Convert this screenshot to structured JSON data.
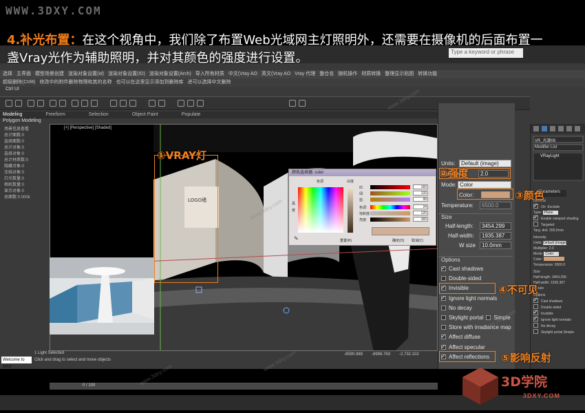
{
  "watermark_top": "WWW.3DXY.COM",
  "headline": {
    "step": "4.补光布置：",
    "text": "在这个视角中，我们除了布置Web光域网主灯照明外，还需要在摄像机的后面布置一盏Vray光作为辅助照明，并对其颜色的强度进行设置。"
  },
  "max_ui": {
    "search_placeholder": "Type a keyword or phrase",
    "menu_row1": [
      "选择",
      "主界面",
      "模型场景创建",
      "渲染对象设置(id)",
      "渲染对象设置(ID)",
      "渲染对象设置(Arch)",
      "导入所有材质",
      "中文(Vray AO",
      "英文(Vray AO",
      "Vray 代理",
      "整合名",
      "随机操作",
      "材质转换",
      "整理显示贴图",
      "转换功能"
    ],
    "menu_row2": [
      "超级删除(Ctrl8)",
      "修改中的附件删除物理和其的名称",
      "也可以在这里显示添加到删除库",
      "进可以选择中文删除"
    ],
    "chip": "Ctrl UI",
    "ribbon_tabs": [
      "Modeling",
      "Freeform",
      "Selection",
      "Object Paint",
      "Populate"
    ],
    "polygon_modeling": "Polygon Modeling",
    "viewport_label": "[+] [Perspective] [Shaded]",
    "left_panel": [
      "场景信息查看",
      "",
      "总计面数:0",
      "选择面数:0",
      "总计对象:0",
      "选择对象:0",
      "总计材质数:0",
      "",
      "隐藏对象:0",
      "冻结对象:0",
      "灯光数量:0",
      "相机数量:0",
      "显示对象:0",
      "",
      "总面数:0.000k"
    ],
    "timeline": "0 / 100",
    "status": {
      "welcome": "Welcome to MAX",
      "selected": "1 Light Selected",
      "hint": "Click and drag to select and move objects",
      "x": "-8590.989",
      "y": "-8998.763",
      "z": "-2,732.102"
    }
  },
  "vray_params": {
    "units_label": "Units:",
    "units_value": "Default (image)",
    "multiplier_label": "Multiplier:",
    "multiplier_value": "2.0",
    "mode_label": "Mode:",
    "mode_value": "Color",
    "color_label": "Color:",
    "color_swatch": "#cfa07a",
    "temperature_label": "Temperature:",
    "temperature_value": "6500.0",
    "size_section": "Size",
    "half_length_label": "Half-length:",
    "half_length_value": "3454.299",
    "half_width_label": "Half-width:",
    "half_width_value": "1935.387",
    "w_size_label": "W size",
    "w_size_value": "10.0mm",
    "options_section": "Options",
    "options": [
      {
        "label": "Cast shadows",
        "checked": true
      },
      {
        "label": "Double-sided",
        "checked": false
      },
      {
        "label": "Invisible",
        "checked": true
      },
      {
        "label": "Ignore light normals",
        "checked": true
      },
      {
        "label": "No decay",
        "checked": false
      },
      {
        "label": "Skylight portal",
        "checked": false,
        "extra": "Simple"
      },
      {
        "label": "Store with irradiance map",
        "checked": false
      },
      {
        "label": "Affect diffuse",
        "checked": true
      },
      {
        "label": "Affect specular",
        "checked": true
      },
      {
        "label": "Affect reflections",
        "checked": true
      }
    ]
  },
  "command_panel": {
    "object_name": "VR_光源06",
    "modifier_list": "Modifier List",
    "stack_item": "VRayLight",
    "rollout": "Parameters",
    "general": "General",
    "on": "On",
    "exclude": "Exclude",
    "type_label": "Type:",
    "type_value": "Plane",
    "enable_viewport": "Enable viewport shading",
    "targeted": "Targeted",
    "targ_dist": "Targ. dist:",
    "targ_dist_value": "200.0mm",
    "intensity": "Intensity",
    "units": "Units:",
    "units_value": "Default (image)",
    "multiplier": "Multiplier:",
    "multiplier_value": "2.0",
    "mode": "Mode:",
    "mode_value": "Color",
    "color": "Color:",
    "temperature": "Temperature:",
    "temperature_value": "6500.0",
    "size": "Size",
    "half_length": "Half-length:",
    "half_length_value": "3454.299",
    "half_width": "Half-width:",
    "half_width_value": "1935.387",
    "w_size": "W size",
    "options_title": "Options",
    "cast_shadows": "Cast shadows",
    "double_sided": "Double-sided",
    "invisible": "Invisible",
    "ignore_normals": "Ignore light normals",
    "no_decay": "No decay",
    "skylight": "Skylight portal",
    "simple": "Simple"
  },
  "color_dialog": {
    "title": "颜色选择器: color",
    "hue_label": "色调",
    "white_label": "白度",
    "black_label": "黑",
    "degree_label": "度",
    "red": "红:",
    "red_value": "183",
    "green": "绿:",
    "green_value": "133",
    "blue": "蓝:",
    "blue_value": "99",
    "hue": "色调:",
    "hue_value": "24",
    "sat": "饱和度:",
    "sat_value": "120",
    "val": "亮度:",
    "val_value": "183",
    "reset": "重置(R)",
    "ok": "确定(O)",
    "cancel": "取消(C)"
  },
  "annotations": {
    "a1": "①VRAY灯",
    "a2": "②强度",
    "a3": "③颜色",
    "a4": "④不可见",
    "a5": "⑤影响反射",
    "logo_text": "LOGO墙"
  },
  "watermark": "www.3dxy.com",
  "logo": {
    "main": "3D学院",
    "sub": "3DXY.COM"
  }
}
